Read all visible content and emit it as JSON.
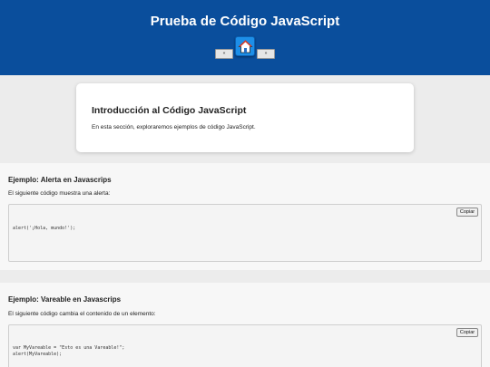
{
  "header": {
    "title": "Prueba de Código JavaScript",
    "prev_label": "«",
    "next_label": "»",
    "home_icon": "home-icon"
  },
  "intro": {
    "title": "Introducción al Código JavaScript",
    "text": "En esta sección, exploraremos ejemplos de código JavaScript."
  },
  "sections": [
    {
      "title": "Ejemplo: Alerta en Javascrips",
      "description": "El siguiente código muestra una alerta:",
      "copy_label": "Copiar",
      "code": "alert('¡Hola, mundo!');"
    },
    {
      "title": "Ejemplo: Vareable en Javascrips",
      "description": "El siguiente código cambia el contenido de un elemento:",
      "copy_label": "Copiar",
      "code": "var MyVareable = \"Esto es una Vareable!\";\nalert(MyVareable);"
    }
  ],
  "colors": {
    "header_bg": "#0a4e9c",
    "home_button": "#1d8fe8"
  }
}
